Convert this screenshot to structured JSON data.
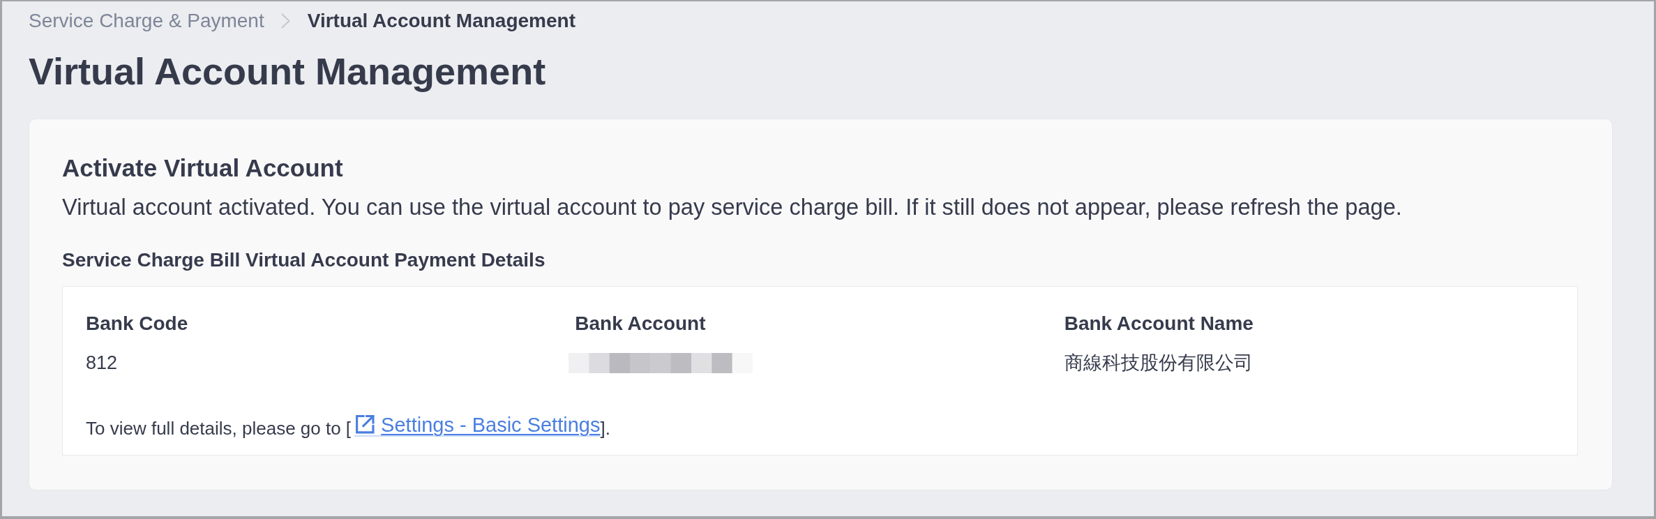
{
  "breadcrumb": [
    {
      "label": "Service Charge & Payment",
      "current": false
    },
    {
      "label": "Virtual Account Management",
      "current": true
    }
  ],
  "page_title": "Virtual Account Management",
  "card": {
    "title": "Activate Virtual Account",
    "message": "Virtual account activated. You can use the virtual account to pay service charge bill. If it still does not appear, please refresh the page.",
    "section_title": "Service Charge Bill Virtual Account Payment Details",
    "details": {
      "fields": [
        {
          "label": "Bank Code",
          "value": "812",
          "redacted": false
        },
        {
          "label": "Bank Account",
          "redacted": true
        },
        {
          "label": "Bank Account Name",
          "value": "商線科技股份有限公司",
          "redacted": false
        }
      ],
      "note": {
        "text_before": "To view full details, please go to [",
        "link": "Settings - Basic Settings",
        "text_after": "]."
      }
    }
  }
}
